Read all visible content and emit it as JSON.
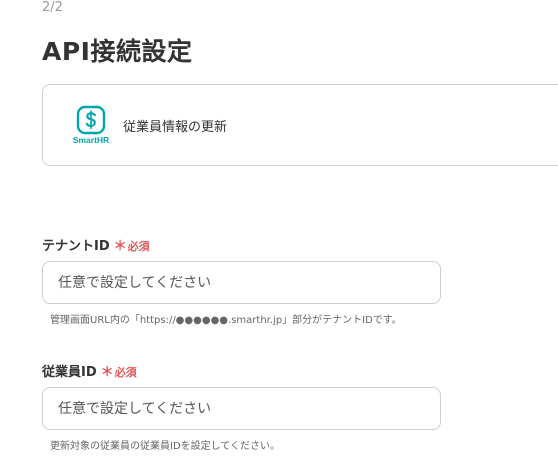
{
  "step": "2/2",
  "title": "API接続設定",
  "app": {
    "brand": "SmartHR",
    "brand_color": "#00a5ab",
    "icon": "smarthr-logo-icon",
    "action": "従業員情報の更新"
  },
  "required_star": "＊",
  "required_text": "必須",
  "required_color": "#e05a5a",
  "fields": [
    {
      "label": "テナントID",
      "placeholder": "任意で設定してください",
      "value": "",
      "help": "管理画面URL内の「https://●●●●●●.smarthr.jp」部分がテナントIDです。"
    },
    {
      "label": "従業員ID",
      "placeholder": "任意で設定してください",
      "value": "",
      "help": "更新対象の従業員の従業員IDを設定してください。"
    }
  ]
}
